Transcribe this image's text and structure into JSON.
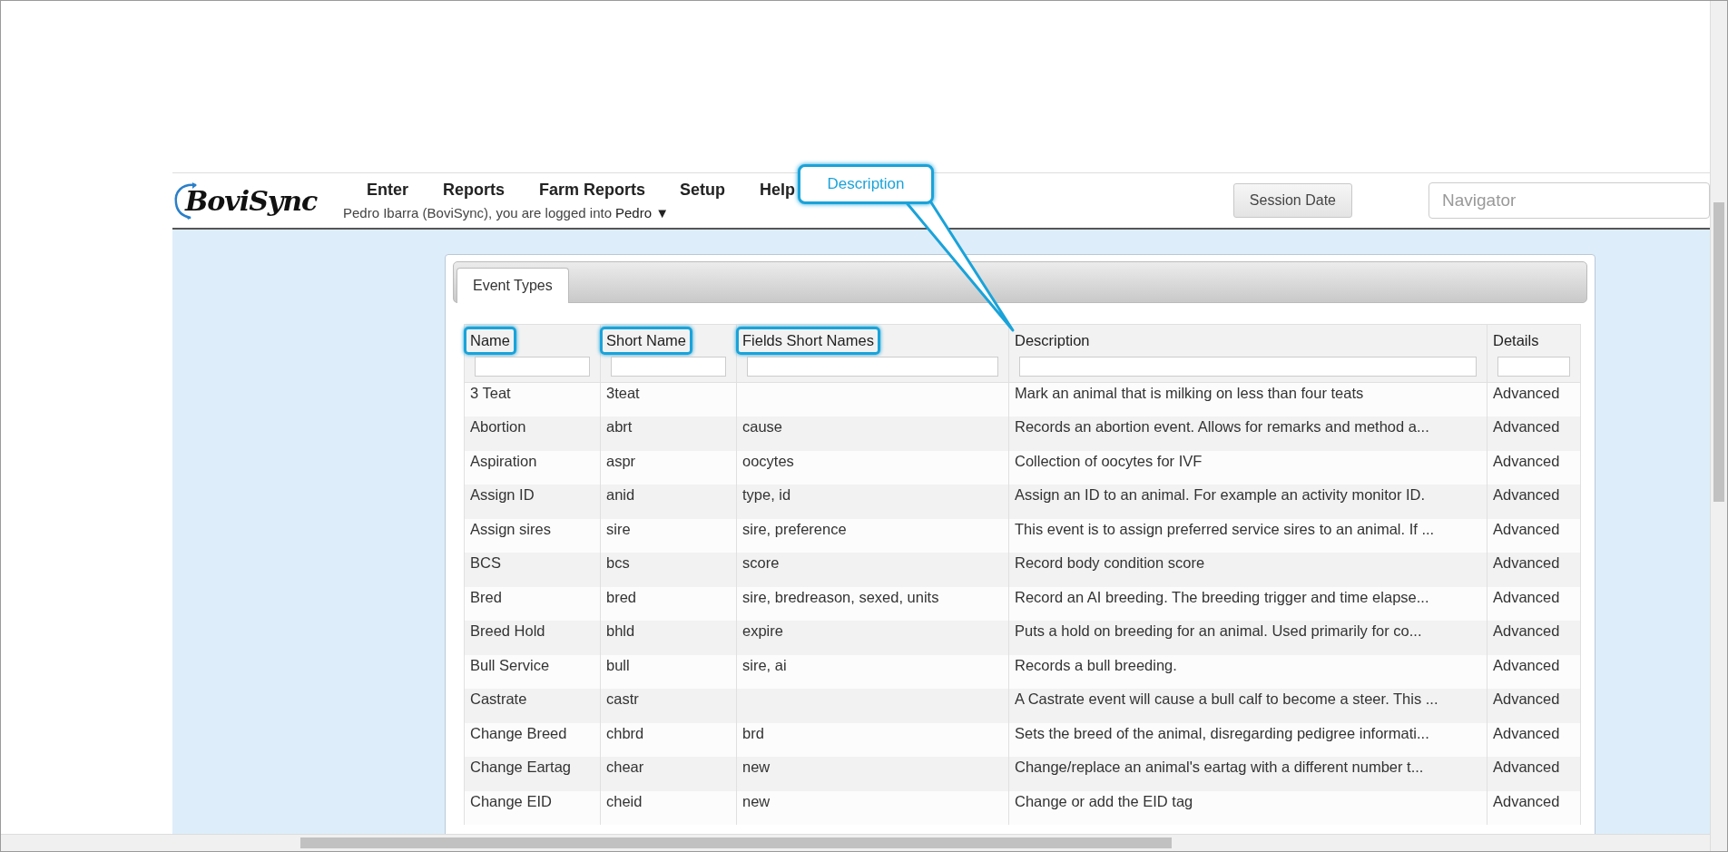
{
  "header": {
    "logo": "BoviSync",
    "nav": [
      "Enter",
      "Reports",
      "Farm Reports",
      "Setup",
      "Help"
    ],
    "user_text": "Pedro Ibarra (BoviSync), you are logged into ",
    "farm": "Pedro",
    "farm_caret": "▼",
    "session_button": "Session Date",
    "navigator": {
      "placeholder": "Navigator"
    }
  },
  "callout": {
    "text": "Description"
  },
  "tabs": [
    {
      "label": "Event Types",
      "selected": true
    }
  ],
  "table": {
    "columns": [
      {
        "label": "Name",
        "highlighted": true
      },
      {
        "label": "Short Name",
        "highlighted": true
      },
      {
        "label": "Fields Short Names",
        "highlighted": true
      },
      {
        "label": "Description",
        "highlighted": false
      },
      {
        "label": "Details",
        "highlighted": false
      }
    ],
    "rows": [
      [
        "3 Teat",
        "3teat",
        "",
        "Mark an animal that is milking on less than four teats",
        "Advanced"
      ],
      [
        "Abortion",
        "abrt",
        "cause",
        "Records an abortion event. Allows for remarks and method a...",
        "Advanced"
      ],
      [
        "Aspiration",
        "aspr",
        "oocytes",
        "Collection of oocytes for IVF",
        "Advanced"
      ],
      [
        "Assign ID",
        "anid",
        "type, id",
        "Assign an ID to an animal. For example an activity monitor ID.",
        "Advanced"
      ],
      [
        "Assign sires",
        "sire",
        "sire, preference",
        "This event is to assign preferred service sires to an animal. If ...",
        "Advanced"
      ],
      [
        "BCS",
        "bcs",
        "score",
        "Record body condition score",
        "Advanced"
      ],
      [
        "Bred",
        "bred",
        "sire, bredreason, sexed, units",
        "Record an AI breeding. The breeding trigger and time elapse...",
        "Advanced"
      ],
      [
        "Breed Hold",
        "bhld",
        "expire",
        "Puts a hold on breeding for an animal. Used primarily for co...",
        "Advanced"
      ],
      [
        "Bull Service",
        "bull",
        "sire, ai",
        "Records a bull breeding.",
        "Advanced"
      ],
      [
        "Castrate",
        "castr",
        "",
        "A Castrate event will cause a bull calf to become a steer. This ...",
        "Advanced"
      ],
      [
        "Change Breed",
        "chbrd",
        "brd",
        "Sets the breed of the animal, disregarding pedigree informati...",
        "Advanced"
      ],
      [
        "Change Eartag",
        "chear",
        "new",
        "Change/replace an animal's eartag with a different number t...",
        "Advanced"
      ],
      [
        "Change EID",
        "cheid",
        "new",
        "Change or add the EID tag",
        "Advanced"
      ]
    ]
  }
}
